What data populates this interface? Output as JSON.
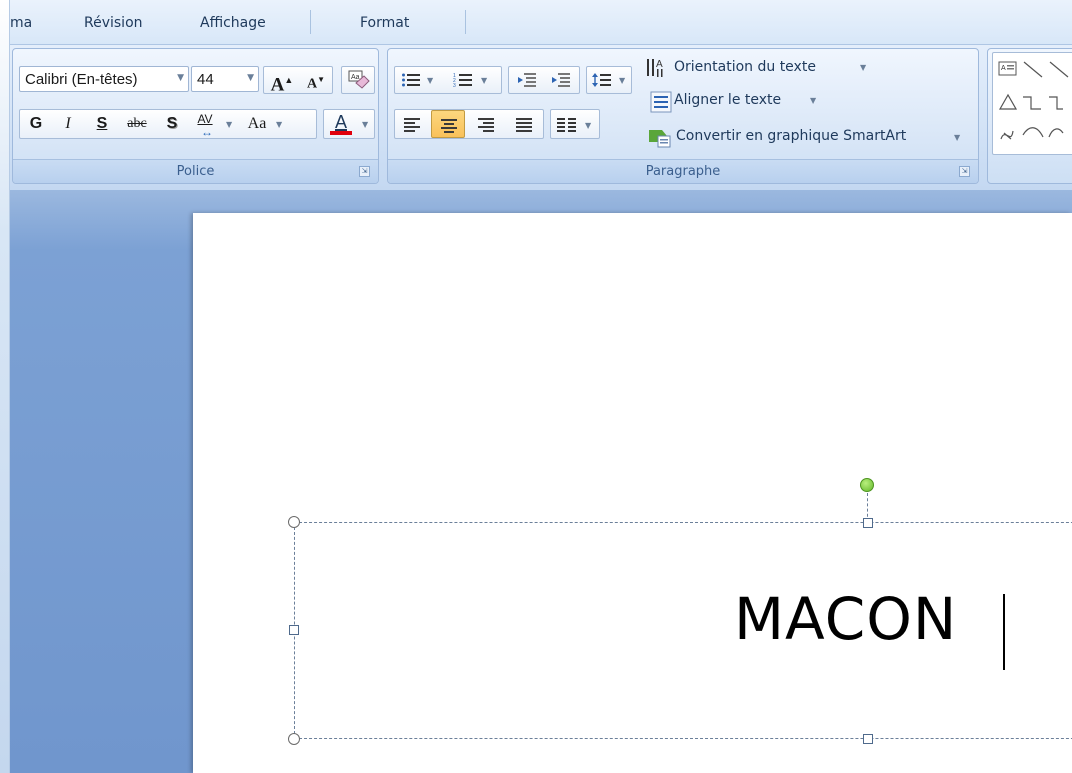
{
  "tabs": [
    {
      "label": "ma"
    },
    {
      "label": "Révision"
    },
    {
      "label": "Affichage"
    },
    {
      "label": "Format"
    }
  ],
  "font_group": {
    "font_name": "Calibri (En-têtes)",
    "font_size": "44",
    "grow_label": "A",
    "shrink_label": "A",
    "bold_label": "G",
    "italic_label": "I",
    "underline_label": "S",
    "strike_label": "abc",
    "shadow_label": "S",
    "spacing_label": "AV",
    "case_label": "Aa",
    "font_color_label": "A",
    "font_color": "#e0000c",
    "label": "Police"
  },
  "paragraph_group": {
    "text_direction": "Orientation du texte",
    "align_text": "Aligner le texte",
    "convert_smartart": "Convertir en graphique SmartArt",
    "label": "Paragraphe",
    "active_alignment": "center",
    "highlight_color": "#fcd77f"
  },
  "slide": {
    "title_text": "MACON"
  }
}
